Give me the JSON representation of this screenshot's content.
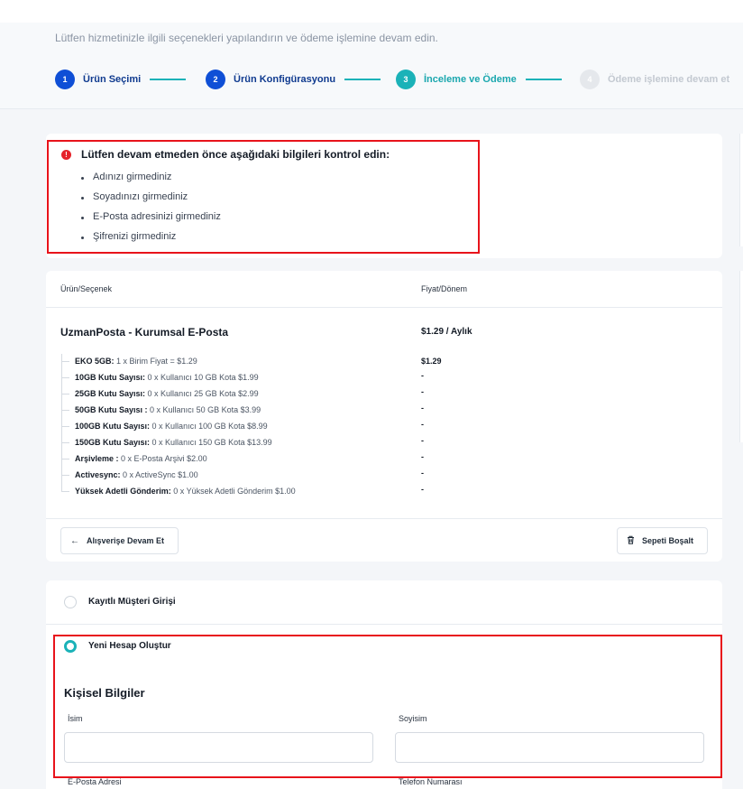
{
  "header": {
    "subtitle": "Lütfen hizmetinizle ilgili seçenekleri yapılandırın ve ödeme işlemine devam edin.",
    "steps": [
      {
        "num": "1",
        "label": "Ürün Seçimi"
      },
      {
        "num": "2",
        "label": "Ürün Konfigürasyonu"
      },
      {
        "num": "3",
        "label": "İnceleme ve Ödeme"
      },
      {
        "num": "4",
        "label": "Ödeme işlemine devam et"
      }
    ]
  },
  "alert": {
    "icon": "!",
    "title": "Lütfen devam etmeden önce aşağıdaki bilgileri kontrol edin:",
    "items": [
      "Adınızı girmediniz",
      "Soyadınızı girmediniz",
      "E-Posta adresinizi girmediniz",
      "Şifrenizi girmediniz"
    ]
  },
  "cart": {
    "col_product": "Ürün/Seçenek",
    "col_price": "Fiyat/Dönem",
    "product_name": "UzmanPosta - Kurumsal E-Posta",
    "product_price": "$1.29 / Aylık",
    "options": [
      {
        "name": "EKO 5GB:",
        "detail": "1 x Birim Fiyat = $1.29",
        "price": "$1.29"
      },
      {
        "name": "10GB Kutu Sayısı:",
        "detail": "0 x Kullanıcı 10 GB Kota $1.99",
        "price": "-"
      },
      {
        "name": "25GB Kutu Sayısı:",
        "detail": "0 x Kullanıcı 25 GB Kota $2.99",
        "price": "-"
      },
      {
        "name": "50GB Kutu Sayısı :",
        "detail": "0 x Kullanıcı 50 GB Kota $3.99",
        "price": "-"
      },
      {
        "name": "100GB Kutu Sayısı:",
        "detail": "0 x Kullanıcı 100 GB Kota $8.99",
        "price": "-"
      },
      {
        "name": "150GB Kutu Sayısı:",
        "detail": "0 x Kullanıcı 150 GB Kota $13.99",
        "price": "-"
      },
      {
        "name": "Arşivleme :",
        "detail": "0 x E-Posta Arşivi $2.00",
        "price": "-"
      },
      {
        "name": "Activesync:",
        "detail": "0 x ActiveSync $1.00",
        "price": "-"
      },
      {
        "name": "Yüksek Adetli Gönderim:",
        "detail": "0 x Yüksek Adetli Gönderim $1.00",
        "price": "-"
      }
    ],
    "continue_label": "Alışverişe Devam Et",
    "empty_label": "Sepeti Boşalt"
  },
  "account": {
    "login_label": "Kayıtlı Müşteri Girişi",
    "new_label": "Yeni Hesap Oluştur",
    "section_title": "Kişisel Bilgiler",
    "first_name_label": "İsim",
    "last_name_label": "Soyisim",
    "email_label": "E-Posta Adresi",
    "phone_label": "Telefon Numarası",
    "first_name_value": "",
    "last_name_value": ""
  }
}
